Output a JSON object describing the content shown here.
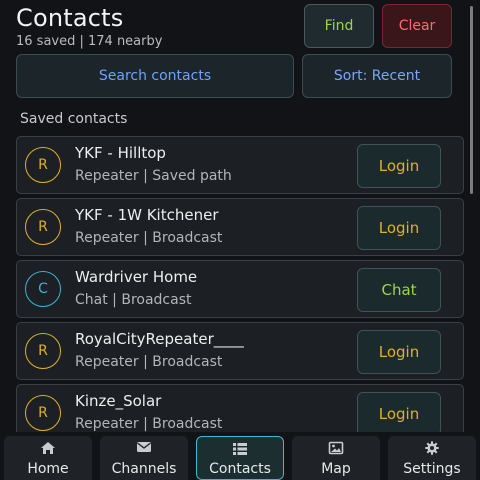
{
  "header": {
    "title": "Contacts",
    "subtitle": "16 saved | 174 nearby",
    "find_label": "Find",
    "clear_label": "Clear"
  },
  "toolbar": {
    "search_label": "Search contacts",
    "sort_label": "Sort: Recent"
  },
  "section_title": "Saved contacts",
  "contacts": [
    {
      "initial": "R",
      "name": "YKF - Hilltop",
      "meta": "Repeater | Saved path",
      "action": "Login",
      "color": "#e0b125"
    },
    {
      "initial": "R",
      "name": "YKF - 1W Kitchener",
      "meta": "Repeater | Broadcast",
      "action": "Login",
      "color": "#e0b125"
    },
    {
      "initial": "C",
      "name": "Wardriver Home",
      "meta": "Chat | Broadcast",
      "action": "Chat",
      "color": "#39b5d6"
    },
    {
      "initial": "R",
      "name": "RoyalCityRepeater____",
      "meta": "Repeater | Broadcast",
      "action": "Login",
      "color": "#e0b125"
    },
    {
      "initial": "R",
      "name": "Kinze_Solar",
      "meta": "Repeater | Broadcast",
      "action": "Login",
      "color": "#e0b125"
    }
  ],
  "action_colors": {
    "Login": "#e0b125",
    "Chat": "#9bd64a"
  },
  "nav": [
    {
      "label": "Home",
      "icon": "home-icon"
    },
    {
      "label": "Channels",
      "icon": "envelope-icon"
    },
    {
      "label": "Contacts",
      "icon": "list-icon",
      "active": true
    },
    {
      "label": "Map",
      "icon": "image-icon"
    },
    {
      "label": "Settings",
      "icon": "gear-icon"
    }
  ]
}
